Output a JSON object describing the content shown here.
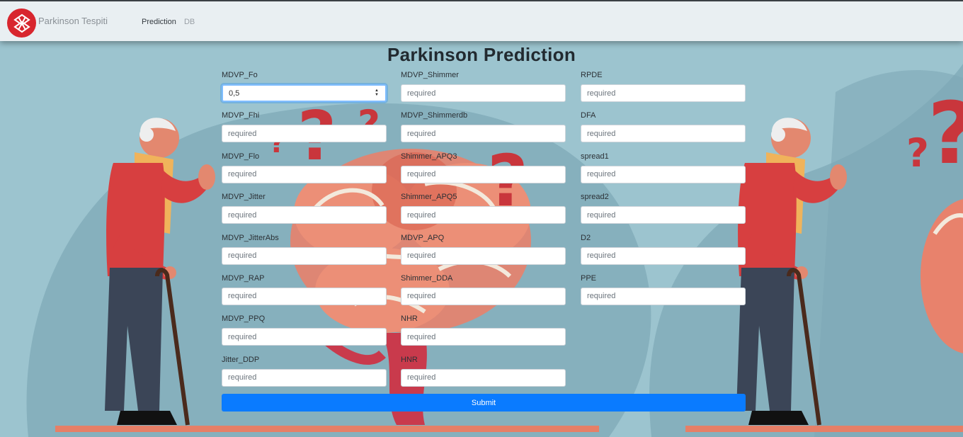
{
  "navbar": {
    "brand": "Parkinson Tespiti",
    "links": [
      "Prediction",
      "DB"
    ]
  },
  "page": {
    "title": "Parkinson Prediction"
  },
  "form": {
    "placeholder": "required",
    "col1": [
      {
        "label": "MDVP_Fo",
        "value": "0,5"
      },
      {
        "label": "MDVP_Fhi",
        "value": ""
      },
      {
        "label": "MDVP_Flo",
        "value": ""
      },
      {
        "label": "MDVP_Jitter",
        "value": ""
      },
      {
        "label": "MDVP_JitterAbs",
        "value": ""
      },
      {
        "label": "MDVP_RAP",
        "value": ""
      },
      {
        "label": "MDVP_PPQ",
        "value": ""
      },
      {
        "label": "Jitter_DDP",
        "value": ""
      }
    ],
    "col2": [
      {
        "label": "MDVP_Shimmer",
        "value": ""
      },
      {
        "label": "MDVP_Shimmerdb",
        "value": ""
      },
      {
        "label": "Shimmer_APQ3",
        "value": ""
      },
      {
        "label": "Shimmer_APQ5",
        "value": ""
      },
      {
        "label": "MDVP_APQ",
        "value": ""
      },
      {
        "label": "Shimmer_DDA",
        "value": ""
      },
      {
        "label": "NHR",
        "value": ""
      },
      {
        "label": "HNR",
        "value": ""
      }
    ],
    "col3": [
      {
        "label": "RPDE",
        "value": ""
      },
      {
        "label": "DFA",
        "value": ""
      },
      {
        "label": "spread1",
        "value": ""
      },
      {
        "label": "spread2",
        "value": ""
      },
      {
        "label": "D2",
        "value": ""
      },
      {
        "label": "PPE",
        "value": ""
      }
    ],
    "submit_label": "Submit"
  },
  "colors": {
    "navbar_bg": "#e9eff2",
    "page_bg": "#9cc4cf",
    "submit_bg": "#0a7bff",
    "logo_red": "#d8262e"
  }
}
